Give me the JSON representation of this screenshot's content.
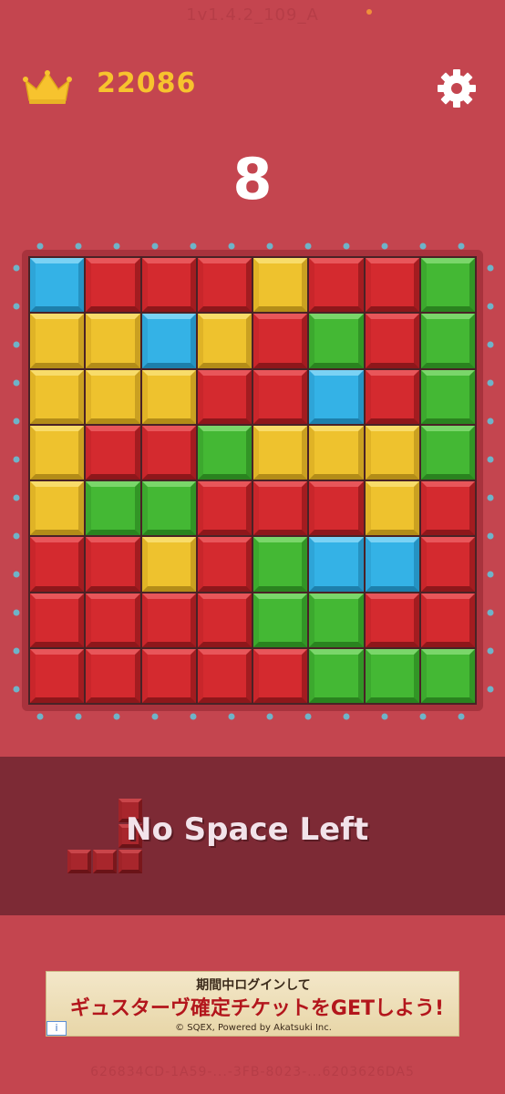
{
  "version_text": "1v1.4.2_109_A",
  "header": {
    "best_score": "22086",
    "crown_icon": "crown-icon",
    "settings_icon": "gear-icon",
    "crown_color": "#f7c32e"
  },
  "score": "8",
  "board": {
    "rows": [
      [
        "blue",
        "red",
        "red",
        "red",
        "yellow",
        "red",
        "red",
        "green"
      ],
      [
        "yellow",
        "yellow",
        "blue",
        "yellow",
        "red",
        "green",
        "red",
        "green"
      ],
      [
        "yellow",
        "yellow",
        "yellow",
        "red",
        "red",
        "blue",
        "red",
        "green"
      ],
      [
        "yellow",
        "red",
        "red",
        "green",
        "yellow",
        "yellow",
        "yellow",
        "green"
      ],
      [
        "yellow",
        "green",
        "green",
        "red",
        "red",
        "red",
        "yellow",
        "red"
      ],
      [
        "red",
        "red",
        "yellow",
        "red",
        "green",
        "blue",
        "blue",
        "red"
      ],
      [
        "red",
        "red",
        "red",
        "red",
        "green",
        "green",
        "red",
        "red"
      ],
      [
        "red",
        "red",
        "red",
        "red",
        "red",
        "green",
        "green",
        "green"
      ]
    ],
    "colors": {
      "red": "#d42a2f",
      "yellow": "#eec22e",
      "blue": "#34b2e6",
      "green": "#44b834"
    }
  },
  "tray": {
    "message": "No Space Left",
    "piece_color": "#a8262c"
  },
  "ad": {
    "line1": "期間中ログインして",
    "line2": "ギュスターヴ確定チケットをGETしよう!",
    "line3": "© SQEX, Powered by Akatsuki Inc.",
    "info_icon": "info-icon"
  },
  "footer_text": "626834CD-1A59-...-3FB-8023-...6203626DA5"
}
